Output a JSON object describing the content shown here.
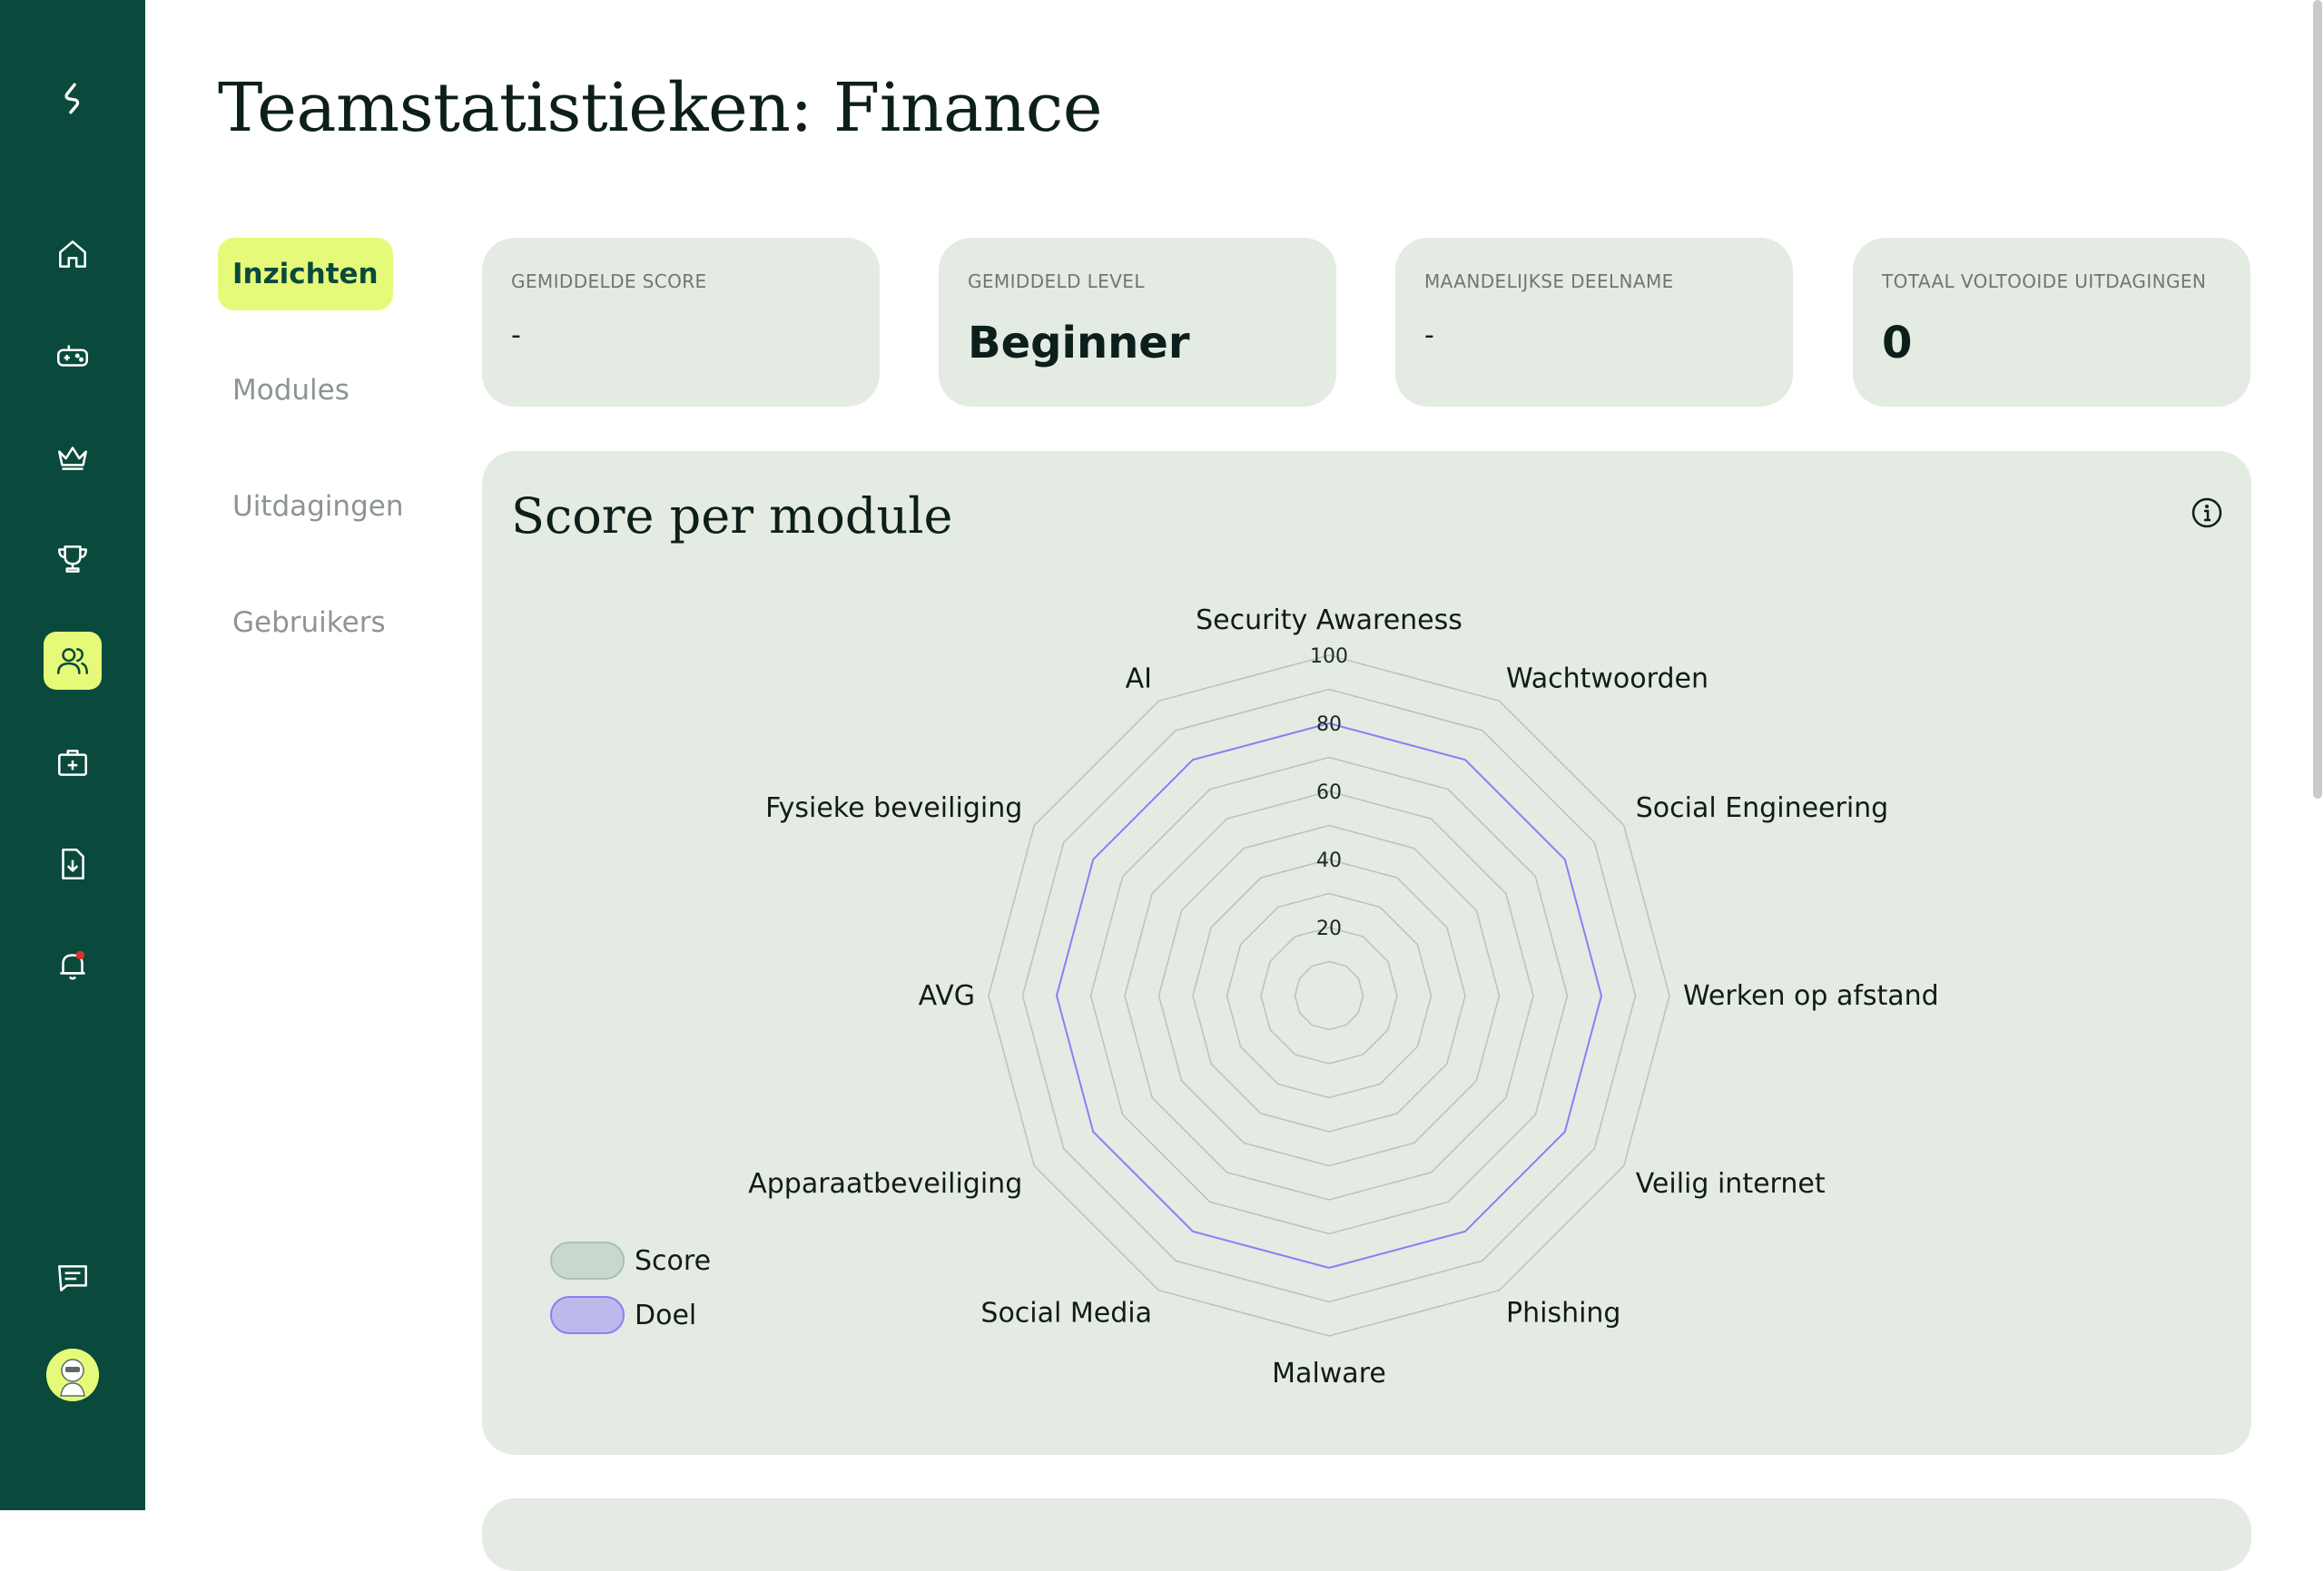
{
  "page": {
    "title": "Teamstatistieken: Finance"
  },
  "sidebar": {
    "items": [
      {
        "icon": "home-icon"
      },
      {
        "icon": "gamepad-icon"
      },
      {
        "icon": "crown-icon"
      },
      {
        "icon": "trophy-icon"
      },
      {
        "icon": "team-icon",
        "active": true
      },
      {
        "icon": "first-aid-kit-icon"
      },
      {
        "icon": "file-download-icon"
      },
      {
        "icon": "bell-icon",
        "badge_color": "#e0302a"
      },
      {
        "icon": "chat-icon"
      }
    ]
  },
  "subnav": {
    "items": [
      {
        "label": "Inzichten",
        "active": true
      },
      {
        "label": "Modules"
      },
      {
        "label": "Uitdagingen"
      },
      {
        "label": "Gebruikers"
      }
    ]
  },
  "stats": [
    {
      "label": "GEMIDDELDE SCORE",
      "value": "-"
    },
    {
      "label": "GEMIDDELD LEVEL",
      "value": "Beginner"
    },
    {
      "label": "MAANDELIJKSE DEELNAME",
      "value": "-"
    },
    {
      "label": "TOTAAL VOLTOOIDE UITDAGINGEN",
      "value": "0"
    }
  ],
  "chart_panel": {
    "title": "Score per module"
  },
  "chart_data": {
    "type": "radar",
    "axes": [
      "Security Awareness",
      "Wachtwoorden",
      "Social Engineering",
      "Werken op afstand",
      "Veilig internet",
      "Phishing",
      "Malware",
      "Social Media",
      "Apparaatbeveiliging",
      "AVG",
      "Fysieke beveiliging",
      "AI"
    ],
    "tick_labels": [
      "20",
      "40",
      "60",
      "80",
      "100"
    ],
    "rlim": [
      0,
      100
    ],
    "grid_levels": [
      10,
      20,
      30,
      40,
      50,
      60,
      70,
      80,
      90,
      100
    ],
    "series": [
      {
        "name": "Score",
        "values": [],
        "color": "#a9c1b5"
      },
      {
        "name": "Doel",
        "values": [
          80,
          80,
          80,
          80,
          80,
          80,
          80,
          80,
          80,
          80,
          80,
          80
        ],
        "color": "#8b7ff5"
      }
    ],
    "legend_position": "bottom-left"
  },
  "colors": {
    "sidebar": "#0a4a3d",
    "accent": "#e6fa79",
    "panel": "#e4ebe2"
  }
}
